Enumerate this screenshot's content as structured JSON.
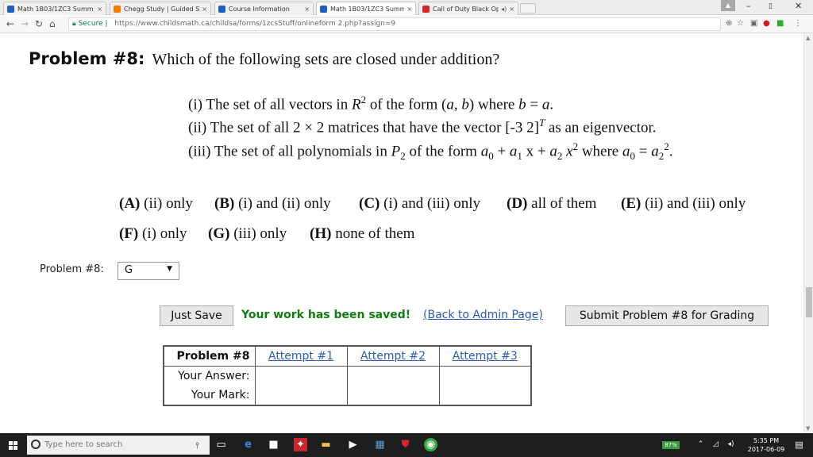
{
  "tabs": [
    {
      "label": "Math 1B03/1ZC3 Summ",
      "close": "×",
      "color": "#1f5fbf"
    },
    {
      "label": "Chegg Study | Guided S",
      "close": "×",
      "color": "#f57a00"
    },
    {
      "label": "Course Information",
      "close": "×",
      "color": "#1f5fbf"
    },
    {
      "label": "Math 1B03/1ZC3 Summ",
      "close": "×",
      "color": "#1f5fbf"
    },
    {
      "label": "Call of Duty Black Op",
      "close": "×",
      "color": "#d9252a"
    }
  ],
  "address": {
    "secure_label": "Secure",
    "url": "https://www.childsmath.ca/childsa/forms/1zcsStuff/onlineform 2.php?assign=9"
  },
  "problem": {
    "title": "Problem #8:",
    "question": "Which of the following sets are closed under addition?",
    "items": {
      "i": [
        "(i) The set of all vectors in ",
        "R",
        "2",
        " of the form (",
        "a",
        ", ",
        "b",
        ") where ",
        "b",
        " = ",
        "a",
        "."
      ],
      "ii": [
        "(ii) The set of all 2 × 2 matrices that have the vector [-3  2]",
        "T",
        " as an eigenvector."
      ],
      "iii": [
        "(iii) The set of all polynomials in ",
        "P",
        "2",
        " of the form ",
        "a",
        "0",
        " + ",
        "a",
        "1",
        " x + ",
        "a",
        "2",
        " x",
        "2",
        " where ",
        "a",
        "0",
        " = ",
        "a",
        "2",
        "2",
        "."
      ]
    },
    "choices": [
      {
        "key": "(A)",
        "text": " (ii) only"
      },
      {
        "key": "(B)",
        "text": " (i) and (ii) only"
      },
      {
        "key": "(C)",
        "text": " (i) and (iii) only"
      },
      {
        "key": "(D)",
        "text": " all of them"
      },
      {
        "key": "(E)",
        "text": " (ii) and (iii) only"
      },
      {
        "key": "(F)",
        "text": " (i) only"
      },
      {
        "key": "(G)",
        "text": " (iii) only"
      },
      {
        "key": "(H)",
        "text": " none of them"
      }
    ]
  },
  "answer_row": {
    "label": "Problem #8:",
    "selected": "G",
    "arrow": "▼"
  },
  "actions": {
    "just_save": "Just Save",
    "saved_message": "Your work has been saved!",
    "back_link": "(Back to Admin Page)",
    "submit": "Submit Problem #8 for Grading"
  },
  "attempts": {
    "header": [
      "Problem #8",
      "Attempt #1",
      "Attempt #2",
      "Attempt #3"
    ],
    "rows": [
      "Your Answer:",
      "Your Mark:"
    ]
  },
  "taskbar": {
    "search_placeholder": "Type here to search",
    "battery": "87%",
    "time": "5:35 PM",
    "date": "2017-06-09"
  }
}
